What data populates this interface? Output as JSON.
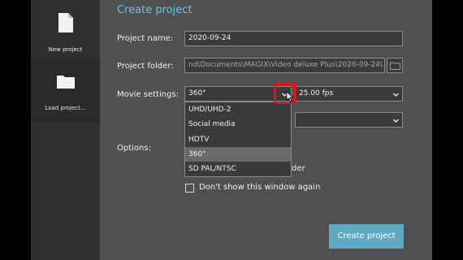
{
  "sidebar": {
    "new_project_label": "New project",
    "load_project_label": "Load project..."
  },
  "dialog": {
    "title": "Create project",
    "project_name": {
      "label": "Project name:",
      "value": "2020-09-24"
    },
    "project_folder": {
      "label": "Project folder:",
      "value": "nd\\Documents\\MAGIX\\Video deluxe Plus\\2020-09-24\\"
    },
    "movie_settings": {
      "label": "Movie settings:",
      "format_value": "360°",
      "fps_value": "25.00 fps",
      "dropdown_options": [
        "UHD/UHD-2",
        "Social media",
        "HDTV",
        "360°",
        "SD PAL/NTSC"
      ],
      "selected_index": 3
    },
    "options_label": "Options:",
    "partial_option_text": "der",
    "dont_show_label": "Don't show this window again",
    "create_button": "Create project"
  },
  "colors": {
    "accent_title": "#6cc3e8",
    "button": "#5fa9c4",
    "highlight_box": "#e0121b"
  }
}
